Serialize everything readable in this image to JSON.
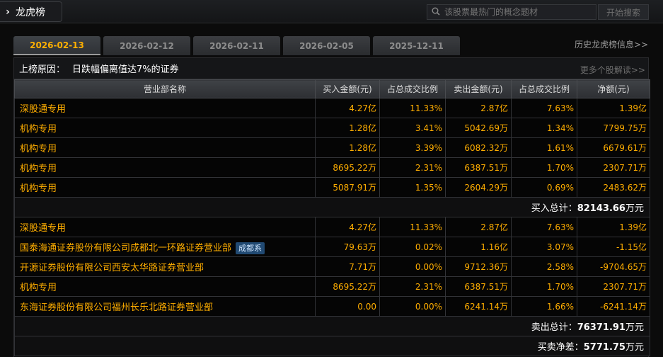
{
  "header": {
    "title": "龙虎榜",
    "search_placeholder": "该股票最热门的概念题材",
    "search_button": "开始搜索"
  },
  "tabs": [
    {
      "label": "2026-02-13",
      "active": true
    },
    {
      "label": "2026-02-12",
      "active": false
    },
    {
      "label": "2026-02-11",
      "active": false
    },
    {
      "label": "2026-02-05",
      "active": false
    },
    {
      "label": "2025-12-11",
      "active": false
    }
  ],
  "history_link": "历史龙虎榜信息>>",
  "reason": {
    "label": "上榜原因：",
    "value": "日跌幅偏离值达7%的证券",
    "more": "更多个股解读>>"
  },
  "columns": [
    "营业部名称",
    "买入金额(元)",
    "占总成交比例",
    "卖出金额(元)",
    "占总成交比例",
    "净额(元)"
  ],
  "buy_rows": [
    {
      "name": "深股通专用",
      "buy": "4.27亿",
      "buy_pct": "11.33%",
      "sell": "2.87亿",
      "sell_pct": "7.63%",
      "net": "1.39亿"
    },
    {
      "name": "机构专用",
      "buy": "1.28亿",
      "buy_pct": "3.41%",
      "sell": "5042.69万",
      "sell_pct": "1.34%",
      "net": "7799.75万"
    },
    {
      "name": "机构专用",
      "buy": "1.28亿",
      "buy_pct": "3.39%",
      "sell": "6082.32万",
      "sell_pct": "1.61%",
      "net": "6679.61万"
    },
    {
      "name": "机构专用",
      "buy": "8695.22万",
      "buy_pct": "2.31%",
      "sell": "6387.51万",
      "sell_pct": "1.70%",
      "net": "2307.71万"
    },
    {
      "name": "机构专用",
      "buy": "5087.91万",
      "buy_pct": "1.35%",
      "sell": "2604.29万",
      "sell_pct": "0.69%",
      "net": "2483.62万"
    }
  ],
  "buy_total": {
    "label": "买入总计：",
    "value": "82143.66",
    "unit": "万元"
  },
  "sell_rows": [
    {
      "name": "深股通专用",
      "badge": "",
      "buy": "4.27亿",
      "buy_pct": "11.33%",
      "sell": "2.87亿",
      "sell_pct": "7.63%",
      "net": "1.39亿"
    },
    {
      "name": "国泰海通证券股份有限公司成都北一环路证券营业部",
      "badge": "成都系",
      "buy": "79.63万",
      "buy_pct": "0.02%",
      "sell": "1.16亿",
      "sell_pct": "3.07%",
      "net": "-1.15亿"
    },
    {
      "name": "开源证券股份有限公司西安太华路证券营业部",
      "badge": "",
      "buy": "7.71万",
      "buy_pct": "0.00%",
      "sell": "9712.36万",
      "sell_pct": "2.58%",
      "net": "-9704.65万"
    },
    {
      "name": "机构专用",
      "badge": "",
      "buy": "8695.22万",
      "buy_pct": "2.31%",
      "sell": "6387.51万",
      "sell_pct": "1.70%",
      "net": "2307.71万"
    },
    {
      "name": "东海证券股份有限公司福州长乐北路证券营业部",
      "badge": "",
      "buy": "0.00",
      "buy_pct": "0.00%",
      "sell": "6241.14万",
      "sell_pct": "1.66%",
      "net": "-6241.14万"
    }
  ],
  "sell_total": {
    "label": "卖出总计：",
    "value": "76371.91",
    "unit": "万元"
  },
  "net_total": {
    "label": "买卖净差：",
    "value": "5771.75",
    "unit": "万元"
  },
  "colors": {
    "accent": "#ffae00",
    "badge_bg": "#214a73"
  }
}
